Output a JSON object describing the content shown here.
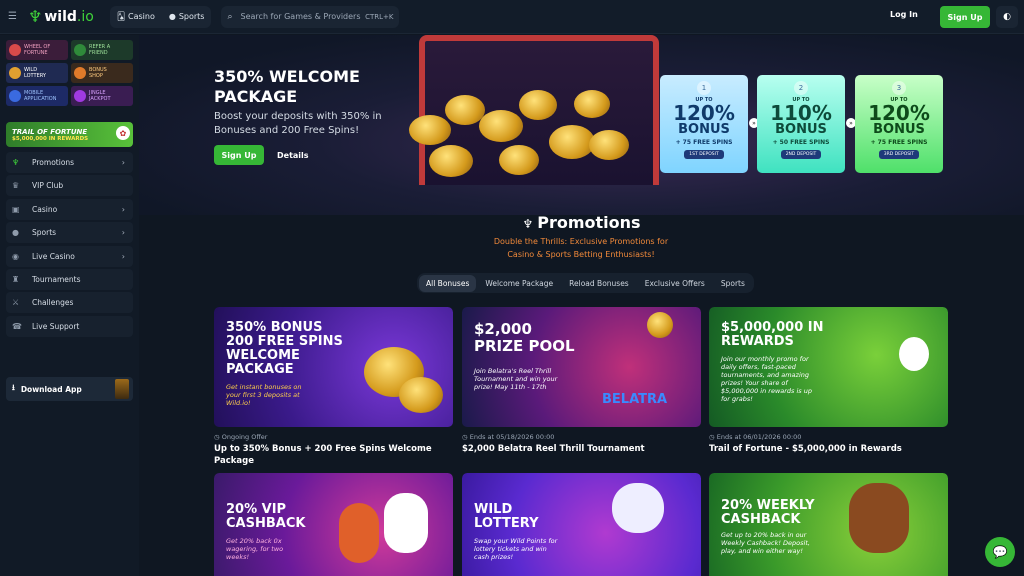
{
  "header": {
    "logo_text": "wild",
    "logo_suffix": ".io",
    "tabs": [
      {
        "label": "Casino",
        "icon": "casino-icon"
      },
      {
        "label": "Sports",
        "icon": "sports-icon"
      }
    ],
    "search": {
      "placeholder": "Search for Games & Providers",
      "shortcut": "CTRL+K"
    },
    "login_label": "Log In",
    "signup_label": "Sign Up"
  },
  "sidebar": {
    "tiles": [
      {
        "line1": "WHEEL OF",
        "line2": "FORTUNE"
      },
      {
        "line1": "REFER A",
        "line2": "FRIEND"
      },
      {
        "line1": "WILD",
        "line2": "LOTTERY"
      },
      {
        "line1": "BONUS",
        "line2": "SHOP"
      },
      {
        "line1": "MOBILE",
        "line2": "APPLICATION"
      },
      {
        "line1": "JINGLE",
        "line2": "JACKPOT"
      }
    ],
    "trail": {
      "line1": "TRAIL OF FORTUNE",
      "line2": "$5,000,000 IN REWARDS"
    },
    "items": [
      {
        "label": "Promotions",
        "chevron": "›"
      },
      {
        "label": "VIP Club",
        "chevron": ""
      },
      {
        "label": "Casino",
        "chevron": "›"
      },
      {
        "label": "Sports",
        "chevron": "›"
      },
      {
        "label": "Live Casino",
        "chevron": "›"
      },
      {
        "label": "Tournaments",
        "chevron": ""
      },
      {
        "label": "Challenges",
        "chevron": ""
      },
      {
        "label": "Live Support",
        "chevron": ""
      }
    ],
    "download_label": "Download App"
  },
  "hero": {
    "title": "350% WELCOME PACKAGE",
    "subtitle": "Boost your deposits with 350% in Bonuses and 200 Free Spins!",
    "signup_label": "Sign Up",
    "details_label": "Details",
    "cards": [
      {
        "num": "1",
        "upto": "UP TO",
        "pct": "120%",
        "bonus": "BONUS",
        "spins": "+ 75 FREE SPINS",
        "deposit": "1ST DEPOSIT"
      },
      {
        "num": "2",
        "upto": "UP TO",
        "pct": "110%",
        "bonus": "BONUS",
        "spins": "+ 50 FREE SPINS",
        "deposit": "2ND DEPOSIT"
      },
      {
        "num": "3",
        "upto": "UP TO",
        "pct": "120%",
        "bonus": "BONUS",
        "spins": "+ 75 FREE SPINS",
        "deposit": "3RD DEPOSIT"
      }
    ]
  },
  "promotions": {
    "title": "Promotions",
    "subtitle": "Double the Thrills: Exclusive Promotions for Casino & Sports Betting Enthusiasts!",
    "filters": [
      "All Bonuses",
      "Welcome Package",
      "Reload Bonuses",
      "Exclusive Offers",
      "Sports"
    ],
    "cards": [
      {
        "big": "350% BONUS 200 FREE SPINS WELCOME PACKAGE",
        "small": "Get instant bonuses on your first 3 deposits at Wild.io!",
        "meta": "Ongoing Offer",
        "title": "Up to 350% Bonus + 200 Free Spins Welcome Package"
      },
      {
        "big": "$2,000 PRIZE POOL",
        "small": "Join Belatra's Reel Thrill Tournament and win your prize! May 11th - 17th",
        "brand": "BELATRA",
        "meta": "Ends at 05/18/2026 00:00",
        "title": "$2,000 Belatra Reel Thrill Tournament"
      },
      {
        "big": "$5,000,000 IN REWARDS",
        "small": "Join our monthly promo for daily offers, fast-paced tournaments, and amazing prizes! Your share of $5,000,000 in rewards is up for grabs!",
        "meta": "Ends at 06/01/2026 00:00",
        "title": "Trail of Fortune - $5,000,000 in Rewards"
      },
      {
        "big": "20% VIP CASHBACK",
        "small": "Get 20% back 0x wagering, for two weeks!"
      },
      {
        "big": "WILD LOTTERY",
        "small": "Swap your Wild Points for lottery tickets and win cash prizes!"
      },
      {
        "big": "20% WEEKLY CASHBACK",
        "small": "Get up to 20% back in our Weekly Cashback! Deposit, play, and win either way!"
      }
    ]
  },
  "colors": {
    "accent": "#36b736",
    "background": "#0f1722",
    "promo_subtitle": "#f0893a"
  }
}
